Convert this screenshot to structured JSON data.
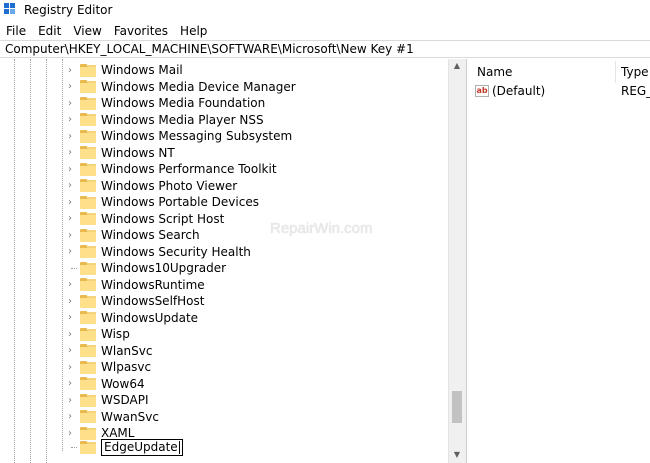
{
  "window": {
    "title": "Registry Editor",
    "app_icon": "registry-icon"
  },
  "menu": {
    "items": [
      "File",
      "Edit",
      "View",
      "Favorites",
      "Help"
    ]
  },
  "address": {
    "path": "Computer\\HKEY_LOCAL_MACHINE\\SOFTWARE\\Microsoft\\New Key #1"
  },
  "tree": {
    "items": [
      {
        "label": "Windows Mail",
        "expandable": true
      },
      {
        "label": "Windows Media Device Manager",
        "expandable": true
      },
      {
        "label": "Windows Media Foundation",
        "expandable": true
      },
      {
        "label": "Windows Media Player NSS",
        "expandable": true
      },
      {
        "label": "Windows Messaging Subsystem",
        "expandable": true
      },
      {
        "label": "Windows NT",
        "expandable": true
      },
      {
        "label": "Windows Performance Toolkit",
        "expandable": true
      },
      {
        "label": "Windows Photo Viewer",
        "expandable": true
      },
      {
        "label": "Windows Portable Devices",
        "expandable": true
      },
      {
        "label": "Windows Script Host",
        "expandable": true
      },
      {
        "label": "Windows Search",
        "expandable": true
      },
      {
        "label": "Windows Security Health",
        "expandable": true
      },
      {
        "label": "Windows10Upgrader",
        "expandable": false
      },
      {
        "label": "WindowsRuntime",
        "expandable": true
      },
      {
        "label": "WindowsSelfHost",
        "expandable": true
      },
      {
        "label": "WindowsUpdate",
        "expandable": true
      },
      {
        "label": "Wisp",
        "expandable": true
      },
      {
        "label": "WlanSvc",
        "expandable": true
      },
      {
        "label": "Wlpasvc",
        "expandable": true
      },
      {
        "label": "Wow64",
        "expandable": true
      },
      {
        "label": "WSDAPI",
        "expandable": true
      },
      {
        "label": "WwanSvc",
        "expandable": true
      },
      {
        "label": "XAML",
        "expandable": true
      }
    ],
    "editing": {
      "value": "EdgeUpdate"
    }
  },
  "values": {
    "columns": {
      "name": "Name",
      "type": "Type"
    },
    "rows": [
      {
        "name": "(Default)",
        "type": "REG_SZ",
        "icon": "string-value-icon"
      }
    ]
  },
  "watermark": "RepairWin.com",
  "colors": {
    "folder": "#ffe08a",
    "folder_tab": "#e8b94d",
    "accent": "#1f6fd0"
  }
}
